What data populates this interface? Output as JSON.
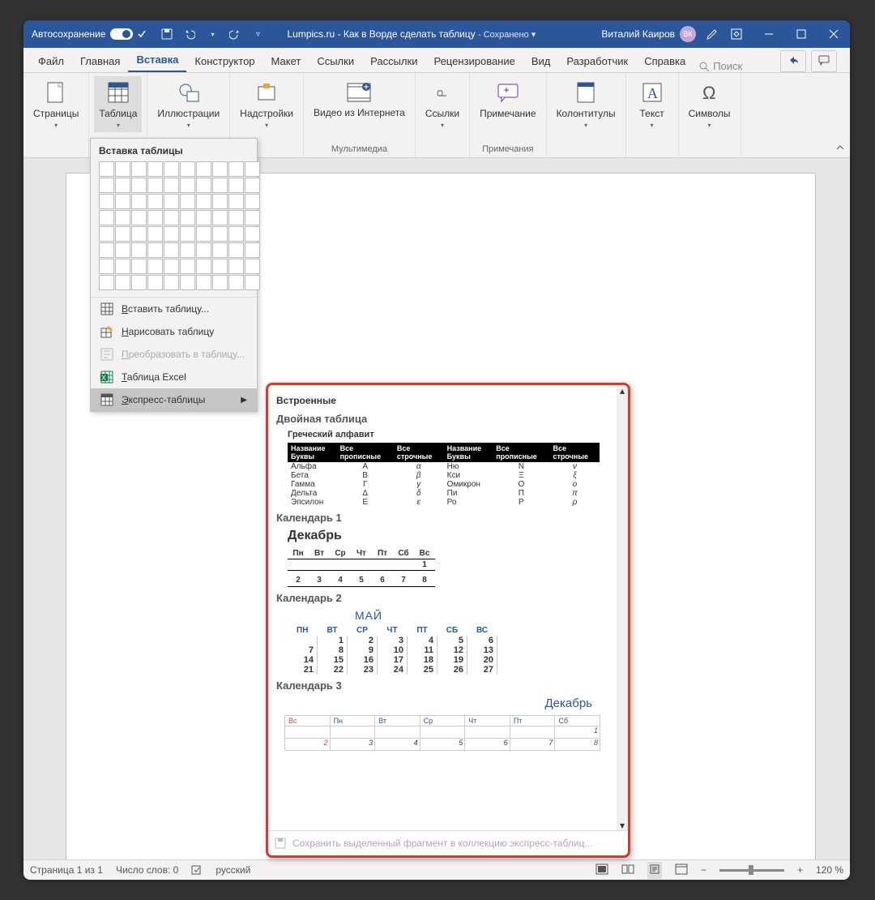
{
  "titlebar": {
    "autosave": "Автосохранение",
    "doc_title": "Lumpics.ru - Как в Ворде сделать таблицу",
    "saved": "- Сохранено ▾",
    "user": "Виталий Каиров",
    "initials": "ВК"
  },
  "tabs": [
    "Файл",
    "Главная",
    "Вставка",
    "Конструктор",
    "Макет",
    "Ссылки",
    "Рассылки",
    "Рецензирование",
    "Вид",
    "Разработчик",
    "Справка"
  ],
  "search": "Поиск",
  "ribbon": {
    "pages": {
      "label": "Страницы",
      "btn": "Страницы"
    },
    "tables": {
      "label": "",
      "btn": "Таблица"
    },
    "illus": {
      "label": "",
      "btn": "Иллюстрации"
    },
    "addins": {
      "label": "",
      "btn": "Надстройки"
    },
    "media": {
      "label": "Мультимедиа",
      "btn": "Видео из Интернета"
    },
    "links": {
      "label": "",
      "btn": "Ссылки"
    },
    "comments": {
      "label": "Примечания",
      "btn": "Примечание"
    },
    "header": {
      "label": "",
      "btn": "Колонтитулы"
    },
    "text": {
      "label": "",
      "btn": "Текст"
    },
    "symbols": {
      "label": "",
      "btn": "Символы"
    }
  },
  "dropdown": {
    "title": "Вставка таблицы",
    "items": {
      "insert": "Вставить таблицу...",
      "draw": "Нарисовать таблицу",
      "convert": "Преобразовать в таблицу...",
      "excel": "Таблица Excel",
      "quick": "Экспресс-таблицы"
    },
    "u": {
      "insert": "В",
      "draw": "Н",
      "convert": "П",
      "excel": "Т",
      "quick": "Э"
    }
  },
  "gallery": {
    "builtin": "Встроенные",
    "double": "Двойная таблица",
    "greek_title": "Греческий алфавит",
    "greek_headers": [
      "Название Буквы",
      "Все прописные",
      "Все строчные",
      "Название Буквы",
      "Все прописные",
      "Все строчные"
    ],
    "greek_rows": [
      [
        "Альфа",
        "A",
        "α",
        "Ню",
        "N",
        "ν"
      ],
      [
        "Бета",
        "B",
        "β",
        "Кси",
        "Ξ",
        "ξ"
      ],
      [
        "Гамма",
        "Γ",
        "γ",
        "Омикрон",
        "O",
        "o"
      ],
      [
        "Дельта",
        "Δ",
        "δ",
        "Пи",
        "Π",
        "π"
      ],
      [
        "Эпсилон",
        "E",
        "ε",
        "Ро",
        "P",
        "ρ"
      ]
    ],
    "cal1": {
      "name": "Календарь 1",
      "month": "Декабрь",
      "days": [
        "Пн",
        "Вт",
        "Ср",
        "Чт",
        "Пт",
        "Сб",
        "Вс"
      ],
      "row1": [
        "",
        "",
        "",
        "",
        "",
        "",
        "1"
      ],
      "row2": [
        "2",
        "3",
        "4",
        "5",
        "6",
        "7",
        "8"
      ]
    },
    "cal2": {
      "name": "Календарь 2",
      "month": "МАЙ",
      "days": [
        "ПН",
        "ВТ",
        "СР",
        "ЧТ",
        "ПТ",
        "СБ",
        "ВС"
      ],
      "rows": [
        [
          "",
          "1",
          "2",
          "3",
          "4",
          "5",
          "6"
        ],
        [
          "7",
          "8",
          "9",
          "10",
          "11",
          "12",
          "13"
        ],
        [
          "14",
          "15",
          "16",
          "17",
          "18",
          "19",
          "20"
        ],
        [
          "21",
          "22",
          "23",
          "24",
          "25",
          "26",
          "27"
        ]
      ]
    },
    "cal3": {
      "name": "Календарь 3",
      "month": "Декабрь",
      "days": [
        "Вс",
        "Пн",
        "Вт",
        "Ср",
        "Чт",
        "Пт",
        "Сб"
      ],
      "rows": [
        [
          "",
          "",
          "",
          "",
          "",
          "",
          "1"
        ],
        [
          "2",
          "3",
          "4",
          "5",
          "6",
          "7",
          "8"
        ]
      ]
    },
    "footer": "Сохранить выделенный фрагмент в коллекцию экспресс-таблиц..."
  },
  "status": {
    "page": "Страница 1 из 1",
    "words": "Число слов: 0",
    "lang": "русский",
    "zoom": "120 %"
  }
}
